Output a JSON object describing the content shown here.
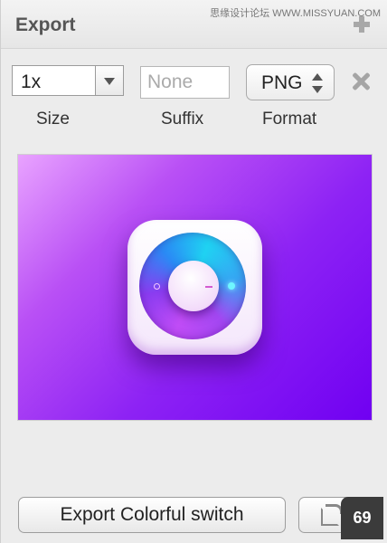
{
  "header": {
    "title": "Export",
    "watermark": "思缘设计论坛 WWW.MISSYUAN.COM"
  },
  "export_row": {
    "size_value": "1x",
    "suffix_placeholder": "None",
    "suffix_value": "",
    "format_value": "PNG",
    "labels": {
      "size": "Size",
      "suffix": "Suffix",
      "format": "Format"
    }
  },
  "icons": {
    "add": "plus-icon",
    "remove": "close-icon",
    "size_dropdown": "chevron-down-icon",
    "format_stepper": "up-down-arrows-icon",
    "share": "share-icon"
  },
  "preview": {
    "gradient_colors": [
      "#e9a3ff",
      "#b950f5",
      "#8d22f4",
      "#7000f2"
    ],
    "subject": "app-icon-dial"
  },
  "footer": {
    "export_label": "Export Colorful switch",
    "badge_count": "69"
  }
}
